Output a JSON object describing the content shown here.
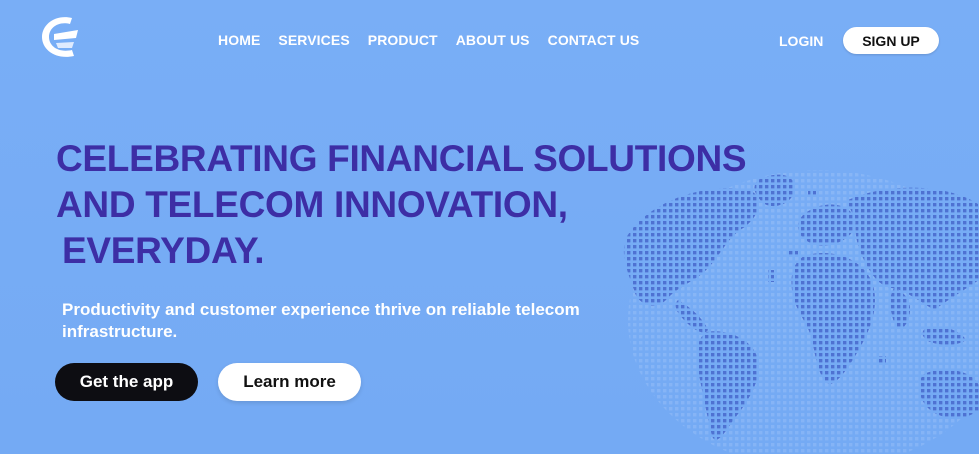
{
  "brand": {
    "logo_icon": "stylized-e-logo-icon"
  },
  "nav": {
    "items": [
      "HOME",
      "SERVICES",
      "PRODUCT",
      "ABOUT US",
      "CONTACT US"
    ],
    "login_label": "LOGIN",
    "signup_label": "SIGN UP"
  },
  "hero": {
    "headline_line1": "CELEBRATING FINANCIAL SOLUTIONS",
    "headline_line2": "AND TELECOM INNOVATION,",
    "headline_line3": "EVERYDAY.",
    "subtitle": "Productivity and customer experience thrive on reliable telecom infrastructure.",
    "primary_button_label": "Get the app",
    "secondary_button_label": "Learn more",
    "image": "dotted-world-globe-icon"
  },
  "colors": {
    "background": "#76acf5",
    "headline": "#3d2ea5",
    "primary_button": "#0d0d12",
    "dots": "#4a6fd0"
  }
}
